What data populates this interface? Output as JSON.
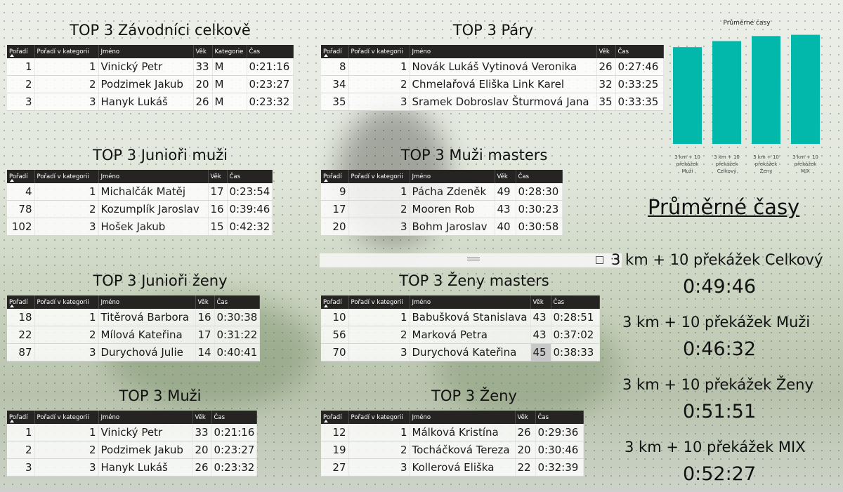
{
  "tables": {
    "overall": {
      "title": "TOP 3 Závodníci celkově",
      "columns": [
        "Pořadí",
        "Pořadí v kategorii",
        "Jméno",
        "Věk",
        "Kategorie",
        "Čas"
      ],
      "rows": [
        [
          "1",
          "1",
          "Vinický Petr",
          "33",
          "M",
          "0:21:16"
        ],
        [
          "2",
          "2",
          "Podzimek Jakub",
          "20",
          "M",
          "0:23:27"
        ],
        [
          "3",
          "3",
          "Hanyk Lukáš",
          "26",
          "M",
          "0:23:32"
        ]
      ]
    },
    "pairs": {
      "title": "TOP 3 Páry",
      "columns": [
        "Pořadí",
        "Pořadí v kategorii",
        "Jméno",
        "Věk",
        "Čas"
      ],
      "rows": [
        [
          "8",
          "1",
          "Novák Lukáš Vytinová Veronika",
          "26",
          "0:27:46"
        ],
        [
          "34",
          "2",
          "Chmelařová Eliška Link Karel",
          "32",
          "0:33:25"
        ],
        [
          "35",
          "3",
          "Sramek Dobroslav Šturmová Jana",
          "35",
          "0:33:35"
        ]
      ]
    },
    "junior_men": {
      "title": "TOP 3 Junioři muži",
      "columns": [
        "Pořadí",
        "Pořadí v kategorii",
        "Jméno",
        "Věk",
        "Čas"
      ],
      "rows": [
        [
          "4",
          "1",
          "Michalčák Matěj",
          "17",
          "0:23:54"
        ],
        [
          "78",
          "2",
          "Kozumplík Jaroslav",
          "16",
          "0:39:46"
        ],
        [
          "102",
          "3",
          "Hošek Jakub",
          "15",
          "0:42:32"
        ]
      ]
    },
    "masters_men": {
      "title": "TOP 3 Muži masters",
      "columns": [
        "Pořadí",
        "Pořadí v kategorii",
        "Jméno",
        "Věk",
        "Čas"
      ],
      "rows": [
        [
          "9",
          "1",
          "Pácha Zdeněk",
          "49",
          "0:28:30"
        ],
        [
          "17",
          "2",
          "Mooren Rob",
          "43",
          "0:30:23"
        ],
        [
          "20",
          "3",
          "Bohm Jaroslav",
          "40",
          "0:30:58"
        ]
      ]
    },
    "junior_women": {
      "title": "TOP 3 Junioři ženy",
      "columns": [
        "Pořadí",
        "Pořadí v kategorii",
        "Jméno",
        "Věk",
        "Čas"
      ],
      "rows": [
        [
          "18",
          "1",
          "Titěrová Barbora",
          "16",
          "0:30:38"
        ],
        [
          "22",
          "2",
          "Mílová Kateřina",
          "17",
          "0:31:22"
        ],
        [
          "87",
          "3",
          "Durychová Julie",
          "14",
          "0:40:41"
        ]
      ]
    },
    "masters_women": {
      "title": "TOP 3 Ženy masters",
      "columns": [
        "Pořadí",
        "Pořadí v kategorii",
        "Jméno",
        "Věk",
        "Čas"
      ],
      "rows": [
        [
          "10",
          "1",
          "Babušková Stanislava",
          "43",
          "0:28:51"
        ],
        [
          "56",
          "2",
          "Marková Petra",
          "43",
          "0:37:02"
        ],
        [
          "70",
          "3",
          "Durychová Kateřina",
          "45",
          "0:38:33"
        ]
      ]
    },
    "men": {
      "title": "TOP 3 Muži",
      "columns": [
        "Pořadí",
        "Pořadí v kategorii",
        "Jméno",
        "Věk",
        "Čas"
      ],
      "rows": [
        [
          "1",
          "1",
          "Vinický Petr",
          "33",
          "0:21:16"
        ],
        [
          "2",
          "2",
          "Podzimek Jakub",
          "20",
          "0:23:27"
        ],
        [
          "3",
          "3",
          "Hanyk Lukáš",
          "26",
          "0:23:32"
        ]
      ]
    },
    "women": {
      "title": "TOP 3 Ženy",
      "columns": [
        "Pořadí",
        "Pořadí v kategorii",
        "Jméno",
        "Věk",
        "Čas"
      ],
      "rows": [
        [
          "12",
          "1",
          "Málková Kristína",
          "26",
          "0:29:36"
        ],
        [
          "19",
          "2",
          "Tocháčková Tereza",
          "20",
          "0:30:46"
        ],
        [
          "27",
          "3",
          "Kollerová Eliška",
          "22",
          "0:32:39"
        ]
      ]
    }
  },
  "chart_data": {
    "type": "bar",
    "title": "Průměrné časy",
    "categories": [
      [
        "3 km + 10",
        "překážek",
        "Muži"
      ],
      [
        "3 km + 10",
        "překážek",
        "Celkový"
      ],
      [
        "3 km + 10",
        "překážek",
        "Ženy"
      ],
      [
        "3 km + 10",
        "překážek",
        "MIX"
      ]
    ],
    "values": [
      0.03231,
      0.03433,
      0.03601,
      0.03643
    ],
    "ylim": [
      0,
      0.0375
    ],
    "bar_color": "#01b8aa"
  },
  "averages": {
    "heading": "Průměrné časy",
    "kpis": [
      {
        "label": "3 km + 10 překážek Celkový",
        "value": "0:49:46"
      },
      {
        "label": "3 km + 10 překážek Muži",
        "value": "0:46:32"
      },
      {
        "label": "3 km + 10 překážek Ženy",
        "value": "0:51:51"
      },
      {
        "label": "3 km + 10 překážek MIX",
        "value": "0:52:27"
      }
    ]
  },
  "visual_header": {
    "focus_icon": "focus-mode-icon",
    "more_icon": "more-options-icon",
    "more_glyph": "⋯"
  },
  "colors": {
    "header_bg": "#252423",
    "accent": "#01b8aa",
    "highlight_cell": "#c8c8c8"
  }
}
